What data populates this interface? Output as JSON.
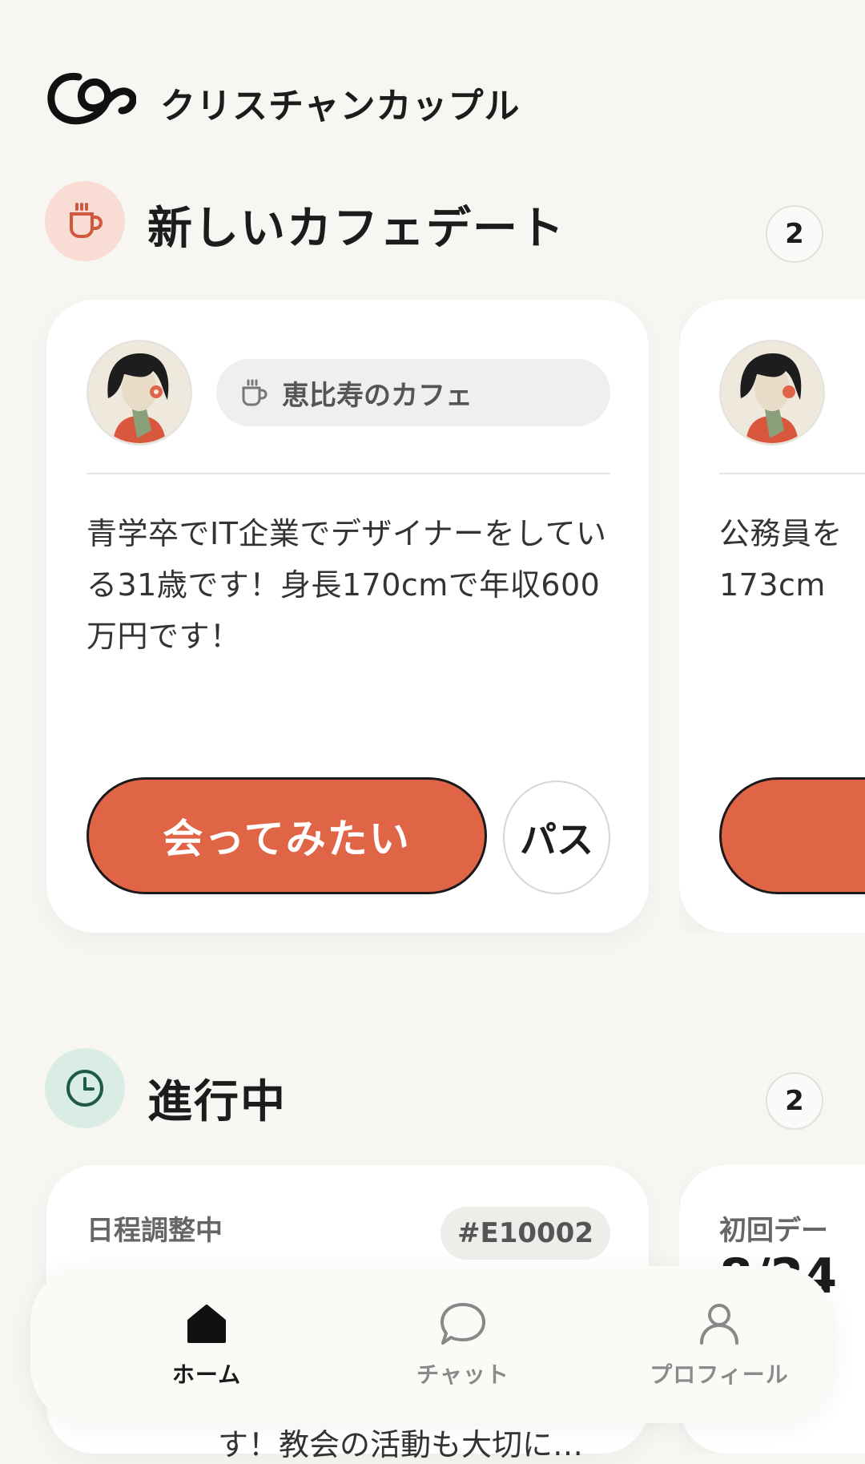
{
  "app": {
    "title": "クリスチャンカップル"
  },
  "sections": {
    "new_dates": {
      "title": "新しいカフェデート",
      "count": "2"
    },
    "in_progress": {
      "title": "進行中",
      "count": "2"
    }
  },
  "cards": [
    {
      "location": "恵比寿のカフェ",
      "bio": "青学卒でIT企業でデザイナーをしている31歳です！身長170cmで年収600万円です！",
      "like_label": "会ってみたい",
      "pass_label": "パス"
    },
    {
      "bio_line1": "公務員を",
      "bio_line2": "173cm"
    }
  ],
  "progress_cards": [
    {
      "status": "日程調整中",
      "id": "#E10002"
    },
    {
      "status": "初回デー",
      "date": "8/24"
    }
  ],
  "underlying_text": "す！教会の活動も大切に…",
  "nav": {
    "items": [
      {
        "label": "ホーム",
        "icon": "home-icon",
        "active": true
      },
      {
        "label": "チャット",
        "icon": "chat-bubble-icon",
        "active": false
      },
      {
        "label": "プロフィール",
        "icon": "user-icon",
        "active": false
      }
    ]
  },
  "colors": {
    "accent": "#e06446",
    "cafe_icon_bg": "#f9ddd4",
    "clock_icon_bg": "#d9ede4",
    "clock_icon": "#1f5a44"
  }
}
